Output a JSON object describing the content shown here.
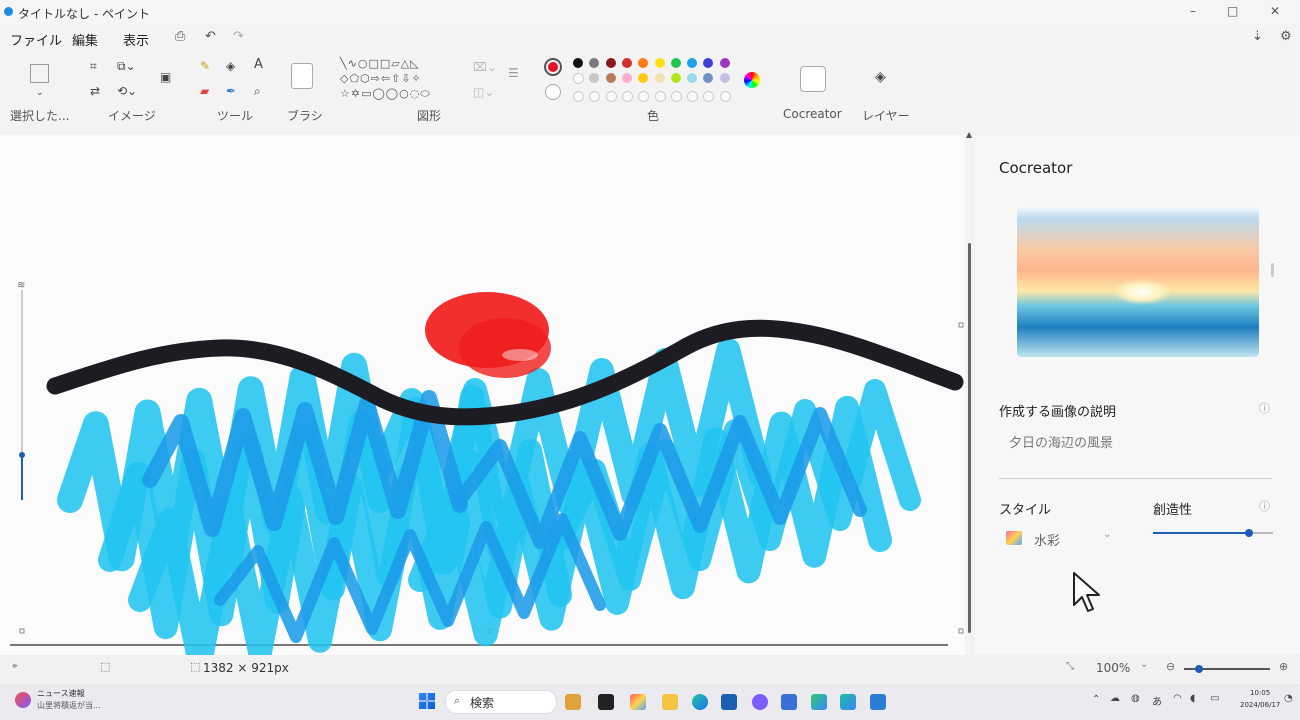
{
  "window": {
    "title": "タイトルなし - ペイント",
    "minimize": "–",
    "maximize": "□",
    "close": "✕"
  },
  "menu": [
    "ファイル",
    "編集",
    "表示"
  ],
  "ribbon": {
    "groups": {
      "select": "選択した...",
      "image": "イメージ",
      "tools": "ツール",
      "brush": "ブラシ",
      "shapes": "図形",
      "colors": "色",
      "cocreator": "Cocreator",
      "layers": "レイヤー"
    },
    "text_tool": "A",
    "shape_rows": [
      "╲∿○□□▱△◺",
      "◇⬠⬡⇨⇦⇧⇩✧",
      "☆✡▭◯◯○◌⬭"
    ],
    "active_color": "#e81123",
    "palette_row1": [
      "#111111",
      "#7a7a7a",
      "#8b1a1a",
      "#d32f2f",
      "#ff7a1a",
      "#ffe014",
      "#23c552",
      "#1fa2e8",
      "#3f3fd6",
      "#9b35c4"
    ],
    "palette_row2": [
      "#ffffff",
      "#c8c8c8",
      "#b97a57",
      "#ffadc9",
      "#ffc90e",
      "#efe4b0",
      "#b5e61d",
      "#99d9ea",
      "#7092be",
      "#c8bfe7"
    ]
  },
  "canvas": {
    "size_label": "1382 × 921px",
    "colors": {
      "sun": "#f01d1d",
      "horizon": "#1c1c22",
      "sea": "#22c4f0",
      "sea_dark": "#1c9be8"
    }
  },
  "cocreator": {
    "title": "Cocreator",
    "description_label": "作成する画像の説明",
    "description_value": "夕日の海辺の風景",
    "style_label": "スタイル",
    "style_value": "水彩",
    "creativity_label": "創造性",
    "creativity_level": 0.8
  },
  "status": {
    "zoom": "100%"
  },
  "taskbar": {
    "news_title": "ニュース速報",
    "news_sub": "山里将積返が当...",
    "search_label": "検索",
    "clock_time": "10:05",
    "clock_date": "2024/06/17"
  }
}
